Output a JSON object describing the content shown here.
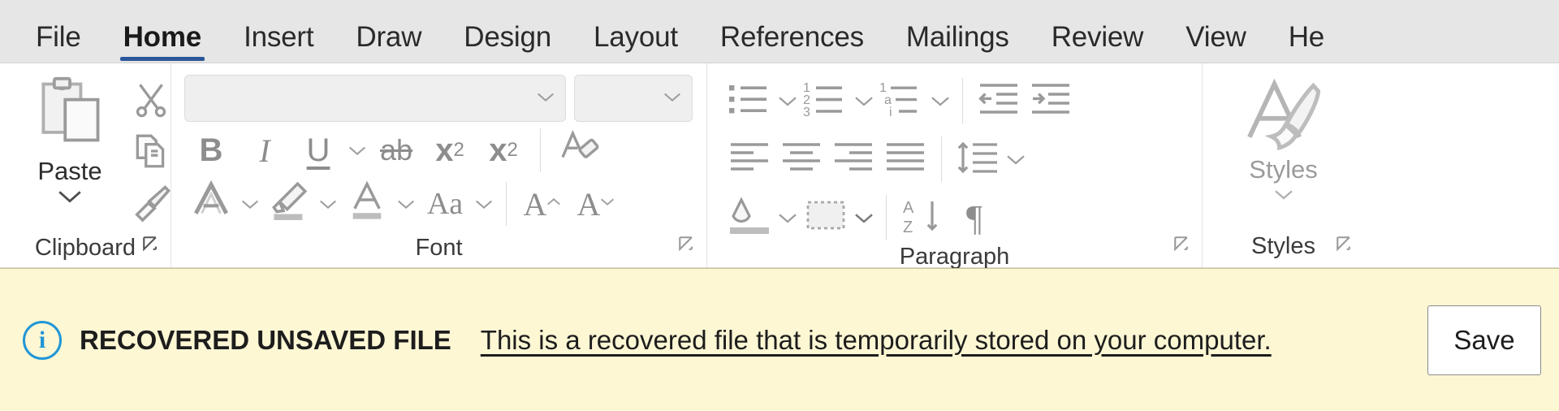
{
  "window": {
    "app": "Microsoft Word",
    "accent_color": "#2b579a",
    "tabstrip_bg": "#e6e6e6",
    "notification_bg": "#fdf7d4"
  },
  "tabs": [
    {
      "label": "File",
      "active": false
    },
    {
      "label": "Home",
      "active": true
    },
    {
      "label": "Insert",
      "active": false
    },
    {
      "label": "Draw",
      "active": false
    },
    {
      "label": "Design",
      "active": false
    },
    {
      "label": "Layout",
      "active": false
    },
    {
      "label": "References",
      "active": false
    },
    {
      "label": "Mailings",
      "active": false
    },
    {
      "label": "Review",
      "active": false
    },
    {
      "label": "View",
      "active": false
    },
    {
      "label": "He",
      "active": false
    }
  ],
  "ribbon": {
    "clipboard": {
      "label": "Clipboard",
      "paste_label": "Paste",
      "paste_icon": "clipboard-paste-icon",
      "paste_caret_icon": "chevron-down-icon",
      "cut_icon": "scissors-icon",
      "copy_icon": "copy-icon",
      "format_painter_icon": "paintbrush-icon",
      "dialog_launcher_icon": "dialog-launcher-icon"
    },
    "font": {
      "label": "Font",
      "font_name": {
        "value": "",
        "placeholder": "",
        "caret_icon": "chevron-down-icon"
      },
      "font_size": {
        "value": "",
        "placeholder": "",
        "caret_icon": "chevron-down-icon"
      },
      "bold_label": "B",
      "italic_label": "I",
      "underline_label": "U",
      "underline_caret_icon": "chevron-down-icon",
      "strikethrough_label": "ab",
      "subscript_label": "x",
      "subscript_sub": "2",
      "superscript_label": "x",
      "superscript_sup": "2",
      "clear_formatting_icon": "clear-formatting-icon",
      "text_effects_icon": "text-effects-icon",
      "text_effects_caret_icon": "chevron-down-icon",
      "highlight_icon": "highlighter-icon",
      "highlight_caret_icon": "chevron-down-icon",
      "font_color_icon": "font-color-icon",
      "font_color_caret_icon": "chevron-down-icon",
      "change_case_label": "Aa",
      "change_case_caret_icon": "chevron-down-icon",
      "grow_font_label": "A",
      "shrink_font_label": "A",
      "dialog_launcher_icon": "dialog-launcher-icon"
    },
    "paragraph": {
      "label": "Paragraph",
      "bullets_icon": "bullet-list-icon",
      "bullets_caret_icon": "chevron-down-icon",
      "numbering_icon": "numbered-list-icon",
      "numbering_digits": [
        "1",
        "2",
        "3"
      ],
      "numbering_caret_icon": "chevron-down-icon",
      "multilevel_icon": "multilevel-list-icon",
      "multilevel_marks": [
        "1",
        "a",
        "i"
      ],
      "multilevel_caret_icon": "chevron-down-icon",
      "decrease_indent_icon": "decrease-indent-icon",
      "increase_indent_icon": "increase-indent-icon",
      "align_left_icon": "align-left-icon",
      "align_center_icon": "align-center-icon",
      "align_right_icon": "align-right-icon",
      "justify_icon": "justify-icon",
      "line_spacing_icon": "line-spacing-icon",
      "line_spacing_caret_icon": "chevron-down-icon",
      "shading_icon": "shading-icon",
      "shading_caret_icon": "chevron-down-icon",
      "borders_icon": "borders-icon",
      "borders_caret_icon": "chevron-down-icon",
      "sort_icon": "sort-az-icon",
      "sort_label_top": "A",
      "sort_label_bottom": "Z",
      "show_marks_label": "¶",
      "dialog_launcher_icon": "dialog-launcher-icon"
    },
    "styles": {
      "label": "Styles",
      "styles_button_label": "Styles",
      "styles_icon": "styles-brush-icon",
      "styles_caret_icon": "chevron-down-icon",
      "dialog_launcher_icon": "dialog-launcher-icon"
    }
  },
  "notification": {
    "info_icon": "info-icon",
    "title": "RECOVERED UNSAVED FILE",
    "message": "This is a recovered file that is temporarily stored on your computer.",
    "save_label": "Save"
  }
}
